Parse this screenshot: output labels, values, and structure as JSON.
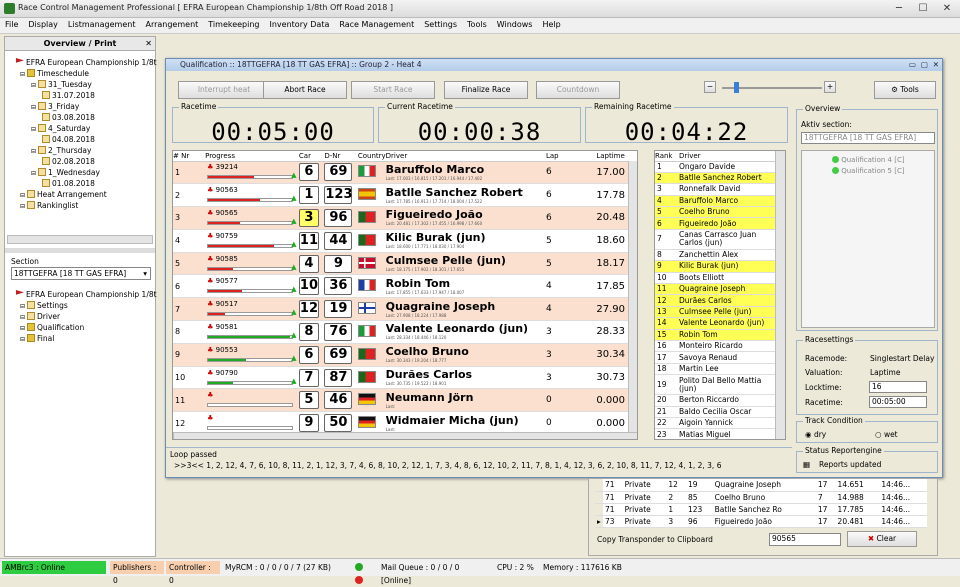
{
  "app": {
    "title": "Race Control Management Professional  [ EFRA European Championship 1/8th Off Road 2018 ]",
    "menu": [
      "File",
      "Display",
      "Listmanagement",
      "Arrangement",
      "Timekeeping",
      "Inventory Data",
      "Race Management",
      "Settings",
      "Tools",
      "Windows",
      "Help"
    ]
  },
  "left": {
    "header": "Overview / Print",
    "close": "✕",
    "tree1": [
      {
        "t": "EFRA European Championship 1/8t",
        "lvl": 0,
        "ic": "flag"
      },
      {
        "t": "Timeschedule",
        "lvl": 1,
        "ic": "fold"
      },
      {
        "t": "31_Tuesday",
        "lvl": 2,
        "ic": "cal"
      },
      {
        "t": "31.07.2018",
        "lvl": 3,
        "ic": "cal"
      },
      {
        "t": "3_Friday",
        "lvl": 2,
        "ic": "cal"
      },
      {
        "t": "03.08.2018",
        "lvl": 3,
        "ic": "cal"
      },
      {
        "t": "4_Saturday",
        "lvl": 2,
        "ic": "cal"
      },
      {
        "t": "04.08.2018",
        "lvl": 3,
        "ic": "cal"
      },
      {
        "t": "2_Thursday",
        "lvl": 2,
        "ic": "cal"
      },
      {
        "t": "02.08.2018",
        "lvl": 3,
        "ic": "cal"
      },
      {
        "t": "1_Wednesday",
        "lvl": 2,
        "ic": "cal"
      },
      {
        "t": "01.08.2018",
        "lvl": 3,
        "ic": "cal"
      },
      {
        "t": "Heat Arrangement",
        "lvl": 1,
        "ic": "cal"
      },
      {
        "t": "Rankinglist",
        "lvl": 1,
        "ic": "cal"
      }
    ],
    "section_label": "Section",
    "section_value": "18TTGEFRA   [18 TT GAS EFRA]",
    "tree2": [
      {
        "t": "EFRA European Championship 1/8t",
        "lvl": 0,
        "ic": "flag"
      },
      {
        "t": "Settings",
        "lvl": 1,
        "ic": "cal"
      },
      {
        "t": "Driver",
        "lvl": 1,
        "ic": "cal"
      },
      {
        "t": "Qualification",
        "lvl": 1,
        "ic": "fold"
      },
      {
        "t": "Final",
        "lvl": 1,
        "ic": "fold"
      }
    ]
  },
  "qual": {
    "title": "Qualification :: 18TTGEFRA  [18 TT GAS EFRA] :: Group 2 - Heat 4",
    "buttons": {
      "interrupt": "Interrupt heat",
      "abort": "Abort Race",
      "start": "Start Race",
      "finalize": "Finalize Race",
      "countdown": "Countdown",
      "tools": "Tools",
      "minus": "−",
      "plus": "+"
    },
    "racetime_label": "Racetime",
    "racetime": "00:05:00",
    "current_label": "Current Racetime",
    "current": "00:00:38",
    "remaining_label": "Remaining Racetime",
    "remaining": "00:04:22",
    "cols": {
      "nr": "# Nr",
      "progress": "Progress",
      "car": "Car",
      "dnr": "D-Nr",
      "country": "Country",
      "driver": "Driver",
      "lap": "Lap",
      "laptime": "Laptime"
    },
    "rows": [
      {
        "nr": "1",
        "tr": "39214",
        "car": "6",
        "dnr": "69",
        "flag": "it",
        "driver": "Baruffolo Marco",
        "sub": "Last: 17.003 / 16.815 / 17.201 / 16.944 / 17.402",
        "lap": "6",
        "time": "17.00",
        "fill": 0.55,
        "col": "#d22"
      },
      {
        "nr": "2",
        "tr": "90563",
        "car": "1",
        "dnr": "123",
        "flag": "es",
        "driver": "Batlle Sanchez Robert",
        "sub": "Last: 17.785 / 16.913 / 17.714 / 18.004 / 17.522",
        "lap": "6",
        "time": "17.78",
        "fill": 0.62,
        "col": "#d22"
      },
      {
        "nr": "3",
        "tr": "90565",
        "car": "3",
        "dnr": "96",
        "flag": "pt",
        "driver": "Figueiredo João",
        "sub": "Last: 20.481 / 17.302 / 17.455 / 16.998 / 17.660",
        "lap": "6",
        "time": "20.48",
        "fill": 0.38,
        "col": "#d22"
      },
      {
        "nr": "4",
        "tr": "90759",
        "car": "11",
        "dnr": "44",
        "flag": "pt",
        "driver": "Kilic Burak (jun)",
        "sub": "Last: 18.600 / 17.771 / 18.030 / 17.904",
        "lap": "5",
        "time": "18.60",
        "fill": 0.78,
        "col": "#d22"
      },
      {
        "nr": "5",
        "tr": "90585",
        "car": "4",
        "dnr": "9",
        "flag": "dk",
        "driver": "Culmsee Pelle (jun)",
        "sub": "Last: 18.175 / 17.902 / 18.301 / 17.655",
        "lap": "5",
        "time": "18.17",
        "fill": 0.3,
        "col": "#d22"
      },
      {
        "nr": "6",
        "tr": "90577",
        "car": "10",
        "dnr": "36",
        "flag": "fr",
        "driver": "Robin Tom",
        "sub": "Last: 17.855 / 17.633 / 17.947 / 18.007",
        "lap": "4",
        "time": "17.85",
        "fill": 0.4,
        "col": "#d22"
      },
      {
        "nr": "7",
        "tr": "90517",
        "car": "12",
        "dnr": "19",
        "flag": "fi",
        "driver": "Quagraine Joseph",
        "sub": "Last: 27.908 / 18.224 / 17.988",
        "lap": "4",
        "time": "27.90",
        "fill": 0.2,
        "col": "#d22"
      },
      {
        "nr": "8",
        "tr": "90581",
        "car": "8",
        "dnr": "76",
        "flag": "it",
        "driver": "Valente Leonardo (jun)",
        "sub": "Last: 28.334 / 18.446 / 18.120",
        "lap": "3",
        "time": "28.33",
        "fill": 0.98,
        "col": "#2a2"
      },
      {
        "nr": "9",
        "tr": "90553",
        "car": "6",
        "dnr": "69",
        "flag": "pt",
        "driver": "Coelho Bruno",
        "sub": "Last: 30.343 / 19.204 / 18.777",
        "lap": "3",
        "time": "30.34",
        "fill": 0.45,
        "col": "#2a2"
      },
      {
        "nr": "10",
        "tr": "90790",
        "car": "7",
        "dnr": "87",
        "flag": "pt",
        "driver": "Durães Carlos",
        "sub": "Last: 30.735 / 19.522 / 18.901",
        "lap": "3",
        "time": "30.73",
        "fill": 0.3,
        "col": "#2a2"
      },
      {
        "nr": "11",
        "tr": "",
        "car": "5",
        "dnr": "46",
        "flag": "de",
        "driver": "Neumann Jörn",
        "sub": "Last:",
        "lap": "0",
        "time": "0.000",
        "fill": 0,
        "col": "#d22"
      },
      {
        "nr": "12",
        "tr": "",
        "car": "9",
        "dnr": "50",
        "flag": "de",
        "driver": "Widmaier Micha (jun)",
        "sub": "Last:",
        "lap": "0",
        "time": "0.000",
        "fill": 0,
        "col": "#d22"
      }
    ],
    "rank_cols": {
      "rank": "Rank",
      "driver": "Driver"
    },
    "rank": [
      {
        "r": "1",
        "d": "Ongaro Davide",
        "y": false
      },
      {
        "r": "2",
        "d": "Batlle Sanchez Robert",
        "y": true
      },
      {
        "r": "3",
        "d": "Ronnefalk David",
        "y": false
      },
      {
        "r": "4",
        "d": "Baruffolo Marco",
        "y": true
      },
      {
        "r": "5",
        "d": "Coelho Bruno",
        "y": true
      },
      {
        "r": "6",
        "d": "Figueiredo João",
        "y": true
      },
      {
        "r": "7",
        "d": "Canas Carrasco Juan Carlos (jun)",
        "y": false,
        "two": true
      },
      {
        "r": "8",
        "d": "Zanchettin Alex",
        "y": false
      },
      {
        "r": "9",
        "d": "Kilic Burak (jun)",
        "y": true
      },
      {
        "r": "10",
        "d": "Boots Elliott",
        "y": false
      },
      {
        "r": "11",
        "d": "Quagraine Joseph",
        "y": true
      },
      {
        "r": "12",
        "d": "Durães Carlos",
        "y": true
      },
      {
        "r": "13",
        "d": "Culmsee Pelle (jun)",
        "y": true
      },
      {
        "r": "14",
        "d": "Valente Leonardo (jun)",
        "y": true
      },
      {
        "r": "15",
        "d": "Robin Tom",
        "y": true
      },
      {
        "r": "16",
        "d": "Monteiro Ricardo",
        "y": false
      },
      {
        "r": "17",
        "d": "Savoya Renaud",
        "y": false
      },
      {
        "r": "18",
        "d": "Martin Lee",
        "y": false
      },
      {
        "r": "19",
        "d": "Polito Dal Bello Mattia (jun)",
        "y": false,
        "two": true
      },
      {
        "r": "20",
        "d": "Berton Riccardo",
        "y": false
      },
      {
        "r": "21",
        "d": "Baldo Cecilia Oscar",
        "y": false
      },
      {
        "r": "22",
        "d": "Aigoin Yannick",
        "y": false
      },
      {
        "r": "23",
        "d": "Matias Miguel",
        "y": false
      }
    ],
    "loop_label": "Loop passed",
    "loop": ">>3<< 1, 2, 12, 4, 7, 6, 10, 8, 11, 2, 1, 12, 3, 7, 4, 6, 8, 10, 2, 12, 1, 7, 3, 4, 8, 6, 12, 10, 2, 11, 7, 8, 1, 4, 12, 3, 6, 2, 10, 8, 11, 7, 12, 4, 1, 2, 3, 6"
  },
  "right": {
    "overview_label": "Overview",
    "aktiv_label": "Aktiv section:",
    "aktiv_value": "18TTGEFRA  [18 TT GAS EFRA]",
    "tree": [
      "Qualification 4  [C]",
      "Qualification 5  [C]"
    ],
    "racesettings_label": "Racesettings",
    "racemode_label": "Racemode:",
    "racemode": "Singlestart Delay",
    "valuation_label": "Valuation:",
    "valuation": "Laptime",
    "locktime_label": "Locktime:",
    "locktime": "16",
    "racetime_label": "Racetime:",
    "racetime": "00:05:00",
    "track_label": "Track Condition",
    "dry": "dry",
    "wet": "wet",
    "status_label": "Status Reportengine",
    "status": "Reports updated"
  },
  "lower": {
    "rows": [
      [
        "71",
        "Private",
        "12",
        "19",
        "Quagraine Joseph",
        "17",
        "14.651",
        "14:46..."
      ],
      [
        "71",
        "Private",
        "2",
        "85",
        "Coelho Bruno",
        "7",
        "14.988",
        "14:46..."
      ],
      [
        "71",
        "Private",
        "1",
        "123",
        "Batlle Sanchez Ro",
        "17",
        "17.785",
        "14:46..."
      ],
      [
        "73",
        "Private",
        "3",
        "96",
        "Figueiredo João",
        "17",
        "20.481",
        "14:46..."
      ]
    ],
    "copy_label": "Copy Transponder to Clipboard",
    "copy_value": "90565",
    "clear": "Clear"
  },
  "status": {
    "amb": "AMBrc3 : Online",
    "publishers": "Publishers : 0",
    "controller": "Controller : 0",
    "myrcm": "MyRCM : 0 / 0 / 0 / 7 (27 KB)",
    "mail": "Mail Queue : 0 / 0 / 0 [Online]",
    "cpu": "CPU : 2 %",
    "memory": "Memory : 117616 KB"
  },
  "colors": {
    "online": "#2ecc40",
    "highlight": "#ffff55",
    "row_alt": "#fbe0cf",
    "accent": "#6a8db3"
  }
}
